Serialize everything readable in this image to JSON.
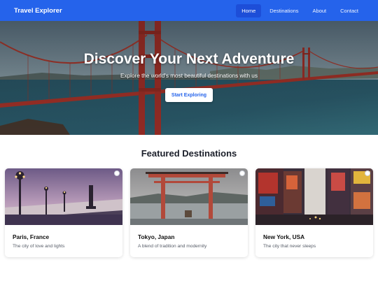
{
  "nav": {
    "brand": "Travel Explorer",
    "links": [
      {
        "label": "Home",
        "active": true
      },
      {
        "label": "Destinations",
        "active": false
      },
      {
        "label": "About",
        "active": false
      },
      {
        "label": "Contact",
        "active": false
      }
    ]
  },
  "hero": {
    "title": "Discover Your Next Adventure",
    "subtitle": "Explore the world's most beautiful destinations with us",
    "cta_label": "Start Exploring"
  },
  "featured": {
    "heading": "Featured Destinations",
    "cards": [
      {
        "title": "Paris, France",
        "description": "The city of love and lights"
      },
      {
        "title": "Tokyo, Japan",
        "description": "A blend of tradition and modernity"
      },
      {
        "title": "New York, USA",
        "description": "The city that never sleeps"
      }
    ]
  },
  "colors": {
    "primary": "#2563eb",
    "primary_dark": "#1d4ed8",
    "background": "#ffffff"
  }
}
